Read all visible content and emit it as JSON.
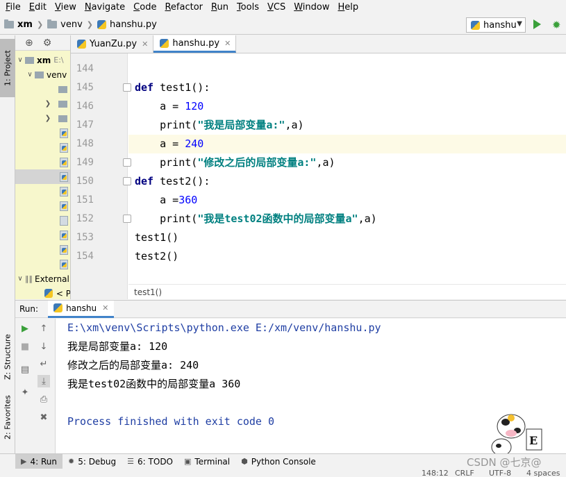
{
  "menu": [
    {
      "label": "File",
      "mn": "F",
      "rest": "ile"
    },
    {
      "label": "Edit",
      "mn": "E",
      "rest": "dit"
    },
    {
      "label": "View",
      "mn": "V",
      "rest": "iew"
    },
    {
      "label": "Navigate",
      "mn": "N",
      "rest": "avigate"
    },
    {
      "label": "Code",
      "mn": "C",
      "rest": "ode"
    },
    {
      "label": "Refactor",
      "mn": "R",
      "rest": "efactor"
    },
    {
      "label": "Run",
      "mn": "R",
      "rest": "un"
    },
    {
      "label": "Tools",
      "mn": "T",
      "rest": "ools"
    },
    {
      "label": "VCS",
      "mn": "V",
      "rest": "CS"
    },
    {
      "label": "Window",
      "mn": "W",
      "rest": "indow"
    },
    {
      "label": "Help",
      "mn": "H",
      "rest": "elp"
    }
  ],
  "breadcrumb": {
    "project": "xm",
    "folder": "venv",
    "file": "hanshu.py"
  },
  "run_config": "hanshu",
  "left_tabs": {
    "project": "1: Project",
    "structure": "Z: Structure",
    "favorites": "2: Favorites"
  },
  "project_tree": {
    "root": "xm",
    "root_path": "E:\\",
    "venv": "venv",
    "external": "External",
    "external_child": "< P"
  },
  "editor_tabs": [
    {
      "label": "YuanZu.py"
    },
    {
      "label": "hanshu.py"
    }
  ],
  "editor": {
    "line_numbers": [
      "144",
      "145",
      "146",
      "147",
      "148",
      "149",
      "150",
      "151",
      "152",
      "153",
      "154"
    ],
    "breadcrumb": "test1()"
  },
  "run_panel": {
    "label": "Run:",
    "tab": "hanshu",
    "command": "E:\\xm\\venv\\Scripts\\python.exe E:/xm/venv/hanshu.py",
    "output": [
      "我是局部变量a: 120",
      "修改之后的局部变量a: 240",
      "我是test02函数中的局部变量a 360"
    ],
    "finished": "Process finished with exit code 0"
  },
  "bottom_tools": [
    {
      "label": "4: Run",
      "icon": "run-icon"
    },
    {
      "label": "5: Debug",
      "icon": "debug-icon"
    },
    {
      "label": "6: TODO",
      "icon": "todo-icon"
    },
    {
      "label": "Terminal",
      "icon": "terminal-icon"
    },
    {
      "label": "Python Console",
      "icon": "python-console-icon"
    }
  ],
  "status": {
    "position": "148:12",
    "line_sep": "CRLF",
    "encoding": "UTF-8",
    "indent": "4 spaces"
  },
  "watermark": "CSDN @七京@",
  "colors": {
    "keyword": "#000080",
    "number": "#0000ff",
    "string": "#008080",
    "accent": "#4083c9",
    "caret_line": "#fdfae6"
  }
}
